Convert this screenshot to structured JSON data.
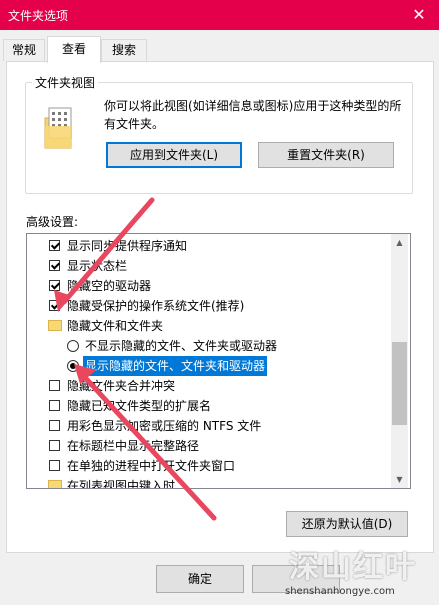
{
  "window": {
    "title": "文件夹选项",
    "close_glyph": "✕"
  },
  "tabs": [
    {
      "label": "常规"
    },
    {
      "label": "查看"
    },
    {
      "label": "搜索"
    }
  ],
  "folder_views": {
    "legend": "文件夹视图",
    "description": "你可以将此视图(如详细信息或图标)应用于这种类型的所有文件夹。",
    "apply_button": "应用到文件夹(L)",
    "reset_button": "重置文件夹(R)"
  },
  "advanced": {
    "label": "高级设置:",
    "items": [
      {
        "type": "checkbox",
        "checked": true,
        "label": "显示同步提供程序通知"
      },
      {
        "type": "checkbox",
        "checked": true,
        "label": "显示状态栏"
      },
      {
        "type": "checkbox",
        "checked": true,
        "label": "隐藏空的驱动器"
      },
      {
        "type": "checkbox",
        "checked": true,
        "label": "隐藏受保护的操作系统文件(推荐)"
      },
      {
        "type": "folder",
        "label": "隐藏文件和文件夹"
      },
      {
        "type": "radio",
        "checked": false,
        "label": "不显示隐藏的文件、文件夹或驱动器"
      },
      {
        "type": "radio",
        "checked": true,
        "selected": true,
        "label": "显示隐藏的文件、文件夹和驱动器"
      },
      {
        "type": "checkbox",
        "checked": false,
        "label": "隐藏文件夹合并冲突"
      },
      {
        "type": "checkbox",
        "checked": false,
        "label": "隐藏已知文件类型的扩展名"
      },
      {
        "type": "checkbox",
        "checked": false,
        "label": "用彩色显示加密或压缩的 NTFS 文件"
      },
      {
        "type": "checkbox",
        "checked": false,
        "label": "在标题栏中显示完整路径"
      },
      {
        "type": "checkbox",
        "checked": false,
        "label": "在单独的进程中打开文件夹窗口"
      },
      {
        "type": "folder",
        "label": "在列表视图中键入时"
      }
    ],
    "restore_button": "还原为默认值(D)"
  },
  "footer": {
    "ok_button": "确定"
  },
  "watermark": {
    "big": "深山红叶",
    "small": "shenshanhongye.com"
  },
  "colors": {
    "titlebar": "#e4004b",
    "arrow": "#e8475f",
    "selection": "#0078d7"
  }
}
